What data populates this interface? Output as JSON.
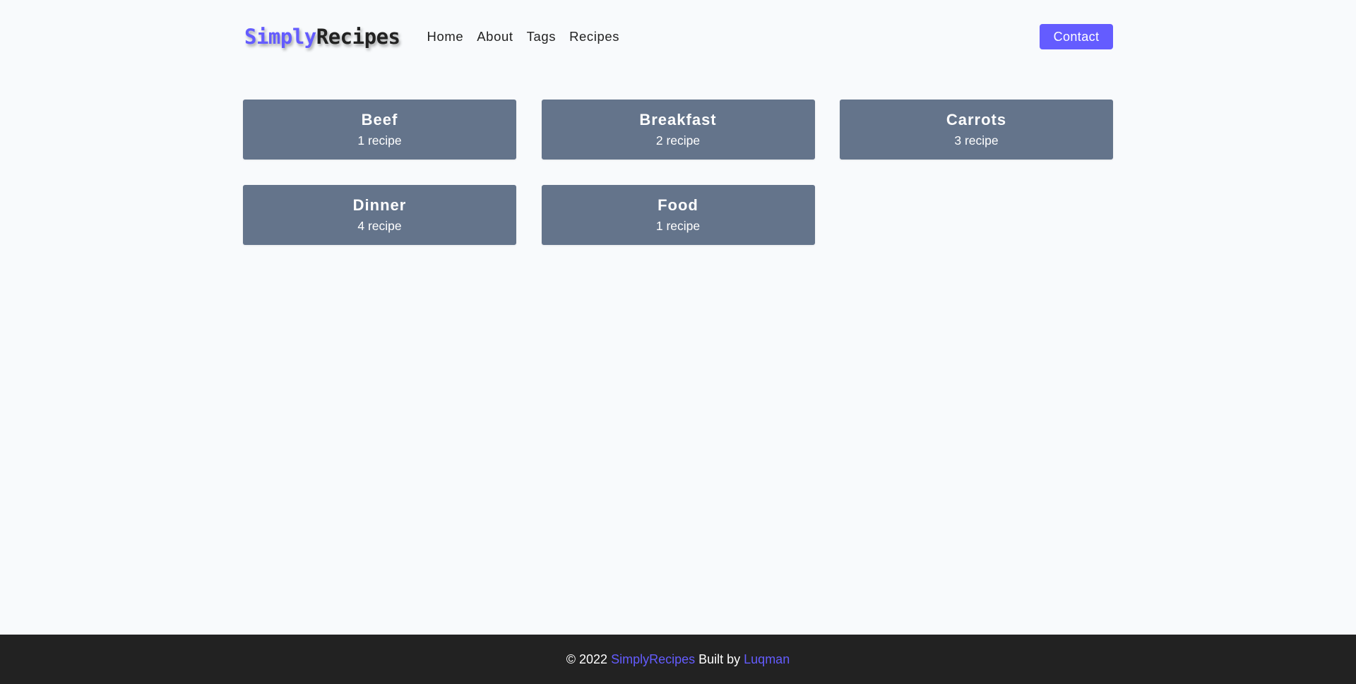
{
  "brand": {
    "part1": "Simply",
    "part2": "Recipes"
  },
  "nav": {
    "links": [
      {
        "label": "Home"
      },
      {
        "label": "About"
      },
      {
        "label": "Tags"
      },
      {
        "label": "Recipes"
      }
    ],
    "contact_label": "Contact"
  },
  "tags": [
    {
      "name": "Beef",
      "count": "1 recipe"
    },
    {
      "name": "Breakfast",
      "count": "2 recipe"
    },
    {
      "name": "Carrots",
      "count": "3 recipe"
    },
    {
      "name": "Dinner",
      "count": "4 recipe"
    },
    {
      "name": "Food",
      "count": "1 recipe"
    }
  ],
  "footer": {
    "copyright": "© 2022 ",
    "site": "SimplyRecipes",
    "built_by": " Built by ",
    "author": "Luqman"
  },
  "colors": {
    "accent": "#645cff",
    "card": "#64748b",
    "footer_bg": "#222222",
    "page_bg": "#f8fafc"
  }
}
